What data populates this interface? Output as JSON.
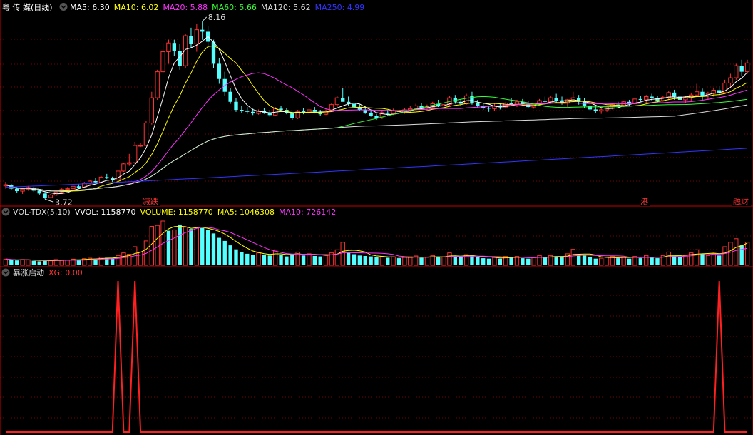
{
  "stock_title": "粤 传 媒(日线)",
  "price_panel": {
    "ma_legend": [
      {
        "label": "MA5: ",
        "value": "6.30",
        "color": "#ffffff"
      },
      {
        "label": "MA10: ",
        "value": "6.02",
        "color": "#ffff00"
      },
      {
        "label": "MA20: ",
        "value": "5.88",
        "color": "#ff33ff"
      },
      {
        "label": "MA60: ",
        "value": "5.66",
        "color": "#33ff33"
      },
      {
        "label": "MA120: ",
        "value": "5.62",
        "color": "#dddddd"
      },
      {
        "label": "MA250: ",
        "value": "4.99",
        "color": "#3333ff"
      }
    ],
    "high_label": "8.16",
    "low_label": "3.72",
    "event_tags": [
      {
        "text": "减跌",
        "x": 200
      },
      {
        "text": "港",
        "x": 898
      },
      {
        "text": "融财",
        "x": 1040
      }
    ]
  },
  "volume_panel": {
    "title": "VOL-TDX(5,10)",
    "vvol_label": "VVOL: ",
    "vvol_value": "1158770",
    "volume_label": "VOLUME: ",
    "volume_value": "1158770",
    "ma5_label": "MA5: ",
    "ma5_value": "1046308",
    "ma10_label": "MA10: ",
    "ma10_value": "726142"
  },
  "indicator_panel": {
    "title": "暴涨启动",
    "xg_label": "XG: ",
    "xg_value": "0.00"
  },
  "colors": {
    "up": "#ff3232",
    "down": "#54ffff",
    "grid": "#7a0000",
    "border": "#c80000"
  },
  "chart_data": {
    "type": "candlestick",
    "ohlc": [
      [
        4.05,
        4.15,
        3.98,
        4.08
      ],
      [
        4.08,
        4.1,
        3.95,
        3.98
      ],
      [
        3.98,
        4.02,
        3.88,
        3.92
      ],
      [
        3.92,
        4.0,
        3.85,
        3.97
      ],
      [
        3.97,
        4.05,
        3.93,
        4.01
      ],
      [
        4.01,
        4.03,
        3.9,
        3.93
      ],
      [
        3.93,
        3.97,
        3.82,
        3.86
      ],
      [
        3.86,
        3.9,
        3.72,
        3.76
      ],
      [
        3.76,
        3.85,
        3.74,
        3.82
      ],
      [
        3.82,
        3.92,
        3.8,
        3.9
      ],
      [
        3.9,
        3.99,
        3.88,
        3.96
      ],
      [
        3.96,
        4.02,
        3.92,
        3.98
      ],
      [
        3.98,
        4.07,
        3.95,
        4.04
      ],
      [
        4.04,
        4.1,
        3.98,
        4.01
      ],
      [
        4.01,
        4.15,
        4.0,
        4.12
      ],
      [
        4.12,
        4.2,
        4.08,
        4.17
      ],
      [
        4.17,
        4.25,
        4.12,
        4.14
      ],
      [
        4.14,
        4.3,
        4.12,
        4.27
      ],
      [
        4.27,
        4.35,
        4.22,
        4.24
      ],
      [
        4.24,
        4.28,
        4.15,
        4.2
      ],
      [
        4.2,
        4.45,
        4.18,
        4.42
      ],
      [
        4.42,
        4.62,
        4.4,
        4.6
      ],
      [
        4.6,
        4.85,
        4.55,
        4.63
      ],
      [
        4.63,
        5.15,
        4.6,
        5.06
      ],
      [
        5.06,
        5.12,
        5.02,
        5.06
      ],
      [
        5.06,
        5.68,
        5.05,
        5.62
      ],
      [
        5.62,
        6.4,
        5.58,
        6.25
      ],
      [
        6.25,
        6.95,
        6.2,
        6.9
      ],
      [
        6.9,
        7.62,
        6.85,
        7.4
      ],
      [
        7.4,
        7.7,
        7.1,
        7.62
      ],
      [
        7.62,
        7.7,
        7.3,
        7.42
      ],
      [
        7.42,
        7.6,
        6.95,
        7.05
      ],
      [
        7.05,
        7.85,
        7.0,
        7.8
      ],
      [
        7.8,
        8.0,
        7.5,
        7.6
      ],
      [
        7.6,
        8.1,
        7.4,
        7.95
      ],
      [
        7.95,
        8.16,
        7.7,
        7.9
      ],
      [
        7.9,
        8.05,
        7.5,
        7.65
      ],
      [
        7.65,
        7.7,
        7.0,
        7.1
      ],
      [
        7.1,
        7.25,
        6.6,
        6.72
      ],
      [
        6.72,
        6.9,
        6.3,
        6.4
      ],
      [
        6.4,
        6.5,
        6.1,
        6.15
      ],
      [
        6.15,
        6.25,
        5.9,
        5.95
      ],
      [
        5.95,
        6.05,
        5.88,
        5.93
      ],
      [
        5.93,
        6.02,
        5.85,
        5.9
      ],
      [
        5.9,
        5.98,
        5.82,
        5.86
      ],
      [
        5.86,
        5.96,
        5.83,
        5.92
      ],
      [
        5.92,
        6.0,
        5.85,
        5.88
      ],
      [
        5.88,
        5.95,
        5.78,
        5.82
      ],
      [
        5.82,
        6.02,
        5.8,
        5.98
      ],
      [
        5.98,
        6.04,
        5.9,
        5.95
      ],
      [
        5.95,
        6.0,
        5.84,
        5.87
      ],
      [
        5.87,
        5.9,
        5.7,
        5.75
      ],
      [
        5.75,
        5.95,
        5.72,
        5.92
      ],
      [
        5.92,
        6.0,
        5.84,
        5.88
      ],
      [
        5.88,
        5.98,
        5.83,
        5.95
      ],
      [
        5.95,
        6.02,
        5.86,
        5.9
      ],
      [
        5.9,
        5.95,
        5.8,
        5.84
      ],
      [
        5.84,
        5.96,
        5.82,
        5.92
      ],
      [
        5.92,
        6.12,
        5.9,
        6.08
      ],
      [
        6.08,
        6.3,
        6.02,
        6.25
      ],
      [
        6.25,
        6.5,
        6.2,
        6.15
      ],
      [
        6.15,
        6.28,
        6.05,
        6.1
      ],
      [
        6.1,
        6.15,
        5.98,
        6.02
      ],
      [
        6.02,
        6.08,
        5.92,
        5.95
      ],
      [
        5.95,
        6.05,
        5.85,
        5.88
      ],
      [
        5.88,
        5.95,
        5.78,
        5.8
      ],
      [
        5.8,
        5.85,
        5.7,
        5.75
      ],
      [
        5.75,
        5.92,
        5.72,
        5.88
      ],
      [
        5.88,
        5.95,
        5.8,
        5.85
      ],
      [
        5.85,
        5.98,
        5.82,
        5.93
      ],
      [
        5.93,
        6.02,
        5.86,
        5.9
      ],
      [
        5.9,
        6.0,
        5.85,
        5.95
      ],
      [
        5.95,
        6.05,
        5.88,
        5.98
      ],
      [
        5.98,
        6.1,
        5.92,
        6.05
      ],
      [
        6.05,
        6.12,
        5.95,
        6.0
      ],
      [
        6.0,
        6.08,
        5.92,
        6.02
      ],
      [
        6.02,
        6.15,
        5.98,
        6.1
      ],
      [
        6.1,
        6.2,
        6.02,
        6.05
      ],
      [
        6.05,
        6.12,
        5.98,
        6.08
      ],
      [
        6.08,
        6.3,
        6.05,
        6.25
      ],
      [
        6.25,
        6.32,
        6.1,
        6.15
      ],
      [
        6.15,
        6.22,
        6.05,
        6.1
      ],
      [
        6.1,
        6.35,
        6.08,
        6.3
      ],
      [
        6.3,
        6.4,
        6.08,
        6.12
      ],
      [
        6.12,
        6.2,
        6.0,
        6.05
      ],
      [
        6.05,
        6.12,
        5.95,
        6.0
      ],
      [
        6.0,
        6.05,
        5.9,
        5.98
      ],
      [
        5.98,
        6.1,
        5.92,
        6.05
      ],
      [
        6.05,
        6.12,
        5.96,
        6.02
      ],
      [
        6.02,
        6.15,
        5.98,
        6.12
      ],
      [
        6.12,
        6.25,
        6.05,
        6.08
      ],
      [
        6.08,
        6.2,
        6.02,
        6.15
      ],
      [
        6.15,
        6.22,
        6.05,
        6.1
      ],
      [
        6.1,
        6.18,
        6.0,
        6.02
      ],
      [
        6.02,
        6.12,
        5.98,
        6.1
      ],
      [
        6.1,
        6.22,
        6.05,
        6.18
      ],
      [
        6.18,
        6.28,
        6.1,
        6.15
      ],
      [
        6.15,
        6.3,
        6.1,
        6.25
      ],
      [
        6.25,
        6.35,
        6.12,
        6.18
      ],
      [
        6.18,
        6.28,
        6.08,
        6.12
      ],
      [
        6.12,
        6.22,
        6.02,
        6.2
      ],
      [
        6.2,
        6.4,
        6.15,
        6.25
      ],
      [
        6.25,
        6.32,
        6.08,
        6.15
      ],
      [
        6.15,
        6.25,
        6.0,
        6.05
      ],
      [
        6.05,
        6.12,
        5.92,
        5.96
      ],
      [
        5.96,
        6.05,
        5.88,
        5.92
      ],
      [
        5.92,
        6.0,
        5.85,
        5.95
      ],
      [
        5.95,
        6.05,
        5.9,
        6.02
      ],
      [
        6.02,
        6.1,
        5.96,
        6.08
      ],
      [
        6.08,
        6.15,
        6.0,
        6.05
      ],
      [
        6.05,
        6.18,
        6.02,
        6.15
      ],
      [
        6.15,
        6.2,
        6.05,
        6.1
      ],
      [
        6.1,
        6.25,
        6.08,
        6.22
      ],
      [
        6.22,
        6.3,
        6.15,
        6.2
      ],
      [
        6.2,
        6.32,
        6.12,
        6.28
      ],
      [
        6.28,
        6.35,
        6.18,
        6.25
      ],
      [
        6.25,
        6.3,
        6.12,
        6.18
      ],
      [
        6.18,
        6.3,
        6.15,
        6.26
      ],
      [
        6.26,
        6.42,
        6.2,
        6.38
      ],
      [
        6.38,
        6.45,
        6.2,
        6.28
      ],
      [
        6.28,
        6.35,
        6.15,
        6.2
      ],
      [
        6.2,
        6.3,
        6.12,
        6.25
      ],
      [
        6.25,
        6.38,
        6.18,
        6.32
      ],
      [
        6.32,
        6.6,
        6.28,
        6.4
      ],
      [
        6.4,
        6.48,
        6.2,
        6.3
      ],
      [
        6.3,
        6.4,
        6.2,
        6.36
      ],
      [
        6.36,
        6.5,
        6.28,
        6.44
      ],
      [
        6.44,
        6.55,
        6.3,
        6.38
      ],
      [
        6.38,
        6.7,
        6.35,
        6.62
      ],
      [
        6.62,
        6.85,
        6.5,
        6.75
      ],
      [
        6.75,
        7.1,
        6.7,
        7.05
      ],
      [
        7.05,
        7.2,
        6.8,
        6.9
      ],
      [
        6.9,
        7.2,
        6.85,
        7.12
      ]
    ],
    "ma_series": {
      "MA5": "#ffffff",
      "MA10": "#ffff00",
      "MA20": "#ff33ff",
      "MA60": "#33ff33",
      "MA120": "#dddddd",
      "MA250": "#3333ff"
    },
    "ma250_range": [
      4.02,
      4.99
    ],
    "y_range": [
      3.6,
      8.3
    ],
    "volume": [
      [
        1,
        0.14
      ],
      [
        0,
        0.12
      ],
      [
        0,
        0.11
      ],
      [
        1,
        0.13
      ],
      [
        1,
        0.12
      ],
      [
        0,
        0.1
      ],
      [
        0,
        0.09
      ],
      [
        0,
        0.1
      ],
      [
        1,
        0.11
      ],
      [
        1,
        0.13
      ],
      [
        1,
        0.12
      ],
      [
        1,
        0.12
      ],
      [
        1,
        0.14
      ],
      [
        0,
        0.12
      ],
      [
        1,
        0.15
      ],
      [
        1,
        0.16
      ],
      [
        0,
        0.15
      ],
      [
        1,
        0.18
      ],
      [
        0,
        0.17
      ],
      [
        0,
        0.16
      ],
      [
        1,
        0.22
      ],
      [
        1,
        0.28
      ],
      [
        1,
        0.25
      ],
      [
        1,
        0.42
      ],
      [
        1,
        0.3
      ],
      [
        1,
        0.55
      ],
      [
        1,
        0.88
      ],
      [
        1,
        0.9
      ],
      [
        1,
        1.0
      ],
      [
        0,
        0.78
      ],
      [
        1,
        0.8
      ],
      [
        0,
        0.92
      ],
      [
        1,
        0.86
      ],
      [
        0,
        0.82
      ],
      [
        1,
        0.85
      ],
      [
        0,
        0.84
      ],
      [
        0,
        0.8
      ],
      [
        0,
        0.72
      ],
      [
        0,
        0.62
      ],
      [
        0,
        0.55
      ],
      [
        0,
        0.45
      ],
      [
        0,
        0.36
      ],
      [
        0,
        0.3
      ],
      [
        0,
        0.26
      ],
      [
        0,
        0.24
      ],
      [
        1,
        0.28
      ],
      [
        0,
        0.23
      ],
      [
        0,
        0.22
      ],
      [
        1,
        0.32
      ],
      [
        0,
        0.24
      ],
      [
        0,
        0.2
      ],
      [
        0,
        0.25
      ],
      [
        1,
        0.3
      ],
      [
        0,
        0.22
      ],
      [
        1,
        0.26
      ],
      [
        0,
        0.21
      ],
      [
        0,
        0.2
      ],
      [
        1,
        0.23
      ],
      [
        1,
        0.28
      ],
      [
        1,
        0.35
      ],
      [
        1,
        0.52
      ],
      [
        0,
        0.3
      ],
      [
        0,
        0.25
      ],
      [
        0,
        0.22
      ],
      [
        0,
        0.21
      ],
      [
        0,
        0.2
      ],
      [
        0,
        0.18
      ],
      [
        1,
        0.2
      ],
      [
        0,
        0.17
      ],
      [
        1,
        0.19
      ],
      [
        0,
        0.16
      ],
      [
        1,
        0.18
      ],
      [
        1,
        0.19
      ],
      [
        1,
        0.21
      ],
      [
        0,
        0.17
      ],
      [
        1,
        0.18
      ],
      [
        1,
        0.22
      ],
      [
        0,
        0.18
      ],
      [
        1,
        0.19
      ],
      [
        1,
        0.28
      ],
      [
        0,
        0.2
      ],
      [
        0,
        0.18
      ],
      [
        1,
        0.24
      ],
      [
        0,
        0.22
      ],
      [
        0,
        0.18
      ],
      [
        0,
        0.16
      ],
      [
        0,
        0.15
      ],
      [
        1,
        0.18
      ],
      [
        0,
        0.15
      ],
      [
        1,
        0.2
      ],
      [
        0,
        0.18
      ],
      [
        1,
        0.2
      ],
      [
        0,
        0.16
      ],
      [
        0,
        0.15
      ],
      [
        1,
        0.18
      ],
      [
        1,
        0.22
      ],
      [
        0,
        0.18
      ],
      [
        1,
        0.22
      ],
      [
        0,
        0.2
      ],
      [
        0,
        0.18
      ],
      [
        1,
        0.26
      ],
      [
        1,
        0.36
      ],
      [
        0,
        0.25
      ],
      [
        0,
        0.22
      ],
      [
        0,
        0.18
      ],
      [
        0,
        0.15
      ],
      [
        1,
        0.16
      ],
      [
        1,
        0.18
      ],
      [
        1,
        0.2
      ],
      [
        0,
        0.16
      ],
      [
        1,
        0.19
      ],
      [
        0,
        0.15
      ],
      [
        1,
        0.2
      ],
      [
        0,
        0.16
      ],
      [
        1,
        0.22
      ],
      [
        0,
        0.17
      ],
      [
        0,
        0.16
      ],
      [
        1,
        0.22
      ],
      [
        1,
        0.3
      ],
      [
        0,
        0.22
      ],
      [
        0,
        0.19
      ],
      [
        1,
        0.22
      ],
      [
        1,
        0.28
      ],
      [
        1,
        0.35
      ],
      [
        0,
        0.26
      ],
      [
        1,
        0.22
      ],
      [
        1,
        0.26
      ],
      [
        0,
        0.22
      ],
      [
        1,
        0.42
      ],
      [
        1,
        0.52
      ],
      [
        1,
        0.6
      ],
      [
        0,
        0.45
      ],
      [
        1,
        0.52
      ]
    ],
    "xg_signal_bars": [
      20,
      23,
      127
    ]
  }
}
